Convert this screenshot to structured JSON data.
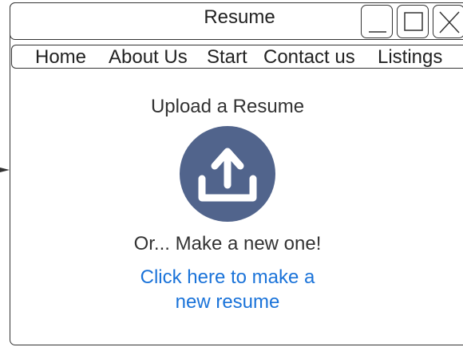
{
  "window": {
    "title": "Resume",
    "controls": [
      {
        "name": "minimize",
        "icon": "minimize-icon"
      },
      {
        "name": "maximize",
        "icon": "maximize-icon"
      },
      {
        "name": "close",
        "icon": "close-icon"
      }
    ]
  },
  "nav": {
    "items": [
      {
        "label": "Home"
      },
      {
        "label": "About Us"
      },
      {
        "label": "Start"
      },
      {
        "label": "Contact us"
      },
      {
        "label": "Listings"
      }
    ]
  },
  "main": {
    "upload_heading": "Upload a Resume",
    "upload_icon": "upload-icon",
    "alternative_text": "Or... Make a new one!",
    "make_link_line1": "Click here to make a",
    "make_link_line2": "new resume"
  },
  "colors": {
    "upload_circle": "#51648c",
    "link": "#1a73d9",
    "outline": "#333333"
  }
}
